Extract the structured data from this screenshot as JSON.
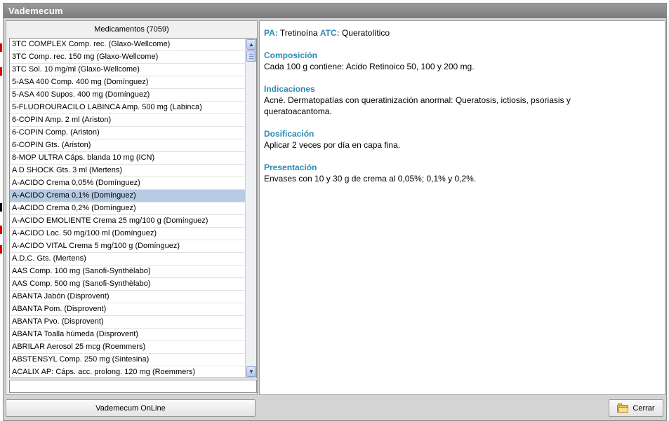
{
  "window": {
    "title": "Vademecum"
  },
  "list": {
    "header": "Medicamentos (7059)",
    "items": [
      "3TC COMPLEX Comp. rec. (Glaxo-Wellcome)",
      "3TC Comp. rec. 150 mg (Glaxo-Wellcome)",
      "3TC Sol. 10 mg/ml (Glaxo-Wellcome)",
      "5-ASA 400 Comp. 400 mg (Domínguez)",
      "5-ASA 400 Supos. 400 mg (Domínguez)",
      "5-FLUOROURACILO LABINCA Amp. 500 mg (Labinca)",
      "6-COPIN Amp. 2 ml (Ariston)",
      "6-COPIN Comp. (Ariston)",
      "6-COPIN Gts. (Ariston)",
      "8-MOP ULTRA Cáps. blanda 10 mg (ICN)",
      "A D SHOCK Gts. 3 ml (Mertens)",
      "A-ACIDO Crema 0,05% (Domínguez)",
      "A-ACIDO Crema 0,1% (Domínguez)",
      "A-ACIDO Crema 0,2% (Domínguez)",
      "A-ACIDO EMOLIENTE Crema 25 mg/100 g (Domínguez)",
      "A-ACIDO Loc. 50 mg/100 ml (Domínguez)",
      "A-ACIDO VITAL Crema 5 mg/100 g (Domínguez)",
      "A.D.C. Gts. (Mertens)",
      "AAS Comp. 100 mg (Sanofi-Synthèlabo)",
      "AAS Comp. 500 mg (Sanofi-Synthèlabo)",
      "ABANTA Jabón (Disprovent)",
      "ABANTA Pom. (Disprovent)",
      "ABANTA Pvo. (Disprovent)",
      "ABANTA Toalla húmeda (Disprovent)",
      "ABRILAR Aerosol 25 mcg (Roemmers)",
      "ABSTENSYL Comp. 250 mg (Sintesina)",
      "ACALIX AP: Cáps. acc. prolong. 120 mg (Roemmers)"
    ],
    "selected_item": "A-ACIDO Crema 0,1% (Domínguez)",
    "search_value": "",
    "scroll_up_icon": "arrow-up-icon",
    "scroll_down_icon": "arrow-down-icon"
  },
  "detail": {
    "pa_label": "PA:",
    "pa_value": "Tretinoína",
    "atc_label": "ATC:",
    "atc_value": "Queratolítico",
    "sections": [
      {
        "title": "Composición",
        "body": "Cada 100 g contiene: Acido Retinoico 50, 100 y 200 mg."
      },
      {
        "title": "Indicaciones",
        "body": "Acné. Dermatopatías con queratinización anormal: Queratosis, ictiosis, psoriasis y queratoacantoma."
      },
      {
        "title": "Dosificación",
        "body": "Aplicar 2 veces por día en capa fina."
      },
      {
        "title": "Presentación",
        "body": "Envases con 10 y 30 g de crema al 0,05%; 0,1% y 0,2%."
      }
    ]
  },
  "buttons": {
    "online_label": "Vademecum OnLine",
    "close_label": "Cerrar",
    "close_icon": "folder-icon"
  },
  "colors": {
    "section_label": "#2b8ab0",
    "selected_row": "#b7cbe4",
    "titlebar": "#8a8a8a"
  }
}
